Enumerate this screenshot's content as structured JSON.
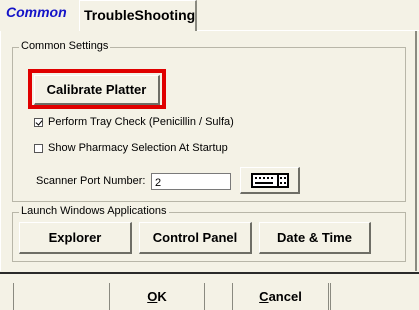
{
  "tabs": [
    {
      "label": "Common",
      "active": true
    },
    {
      "label": "TroubleShooting",
      "active": false
    }
  ],
  "common_settings": {
    "legend": "Common Settings",
    "calibrate_label": "Calibrate Platter",
    "tray_check": {
      "label": "Perform Tray Check (Penicillin / Sulfa)",
      "checked": true
    },
    "pharmacy_selection": {
      "label": "Show Pharmacy Selection At Startup",
      "checked": false
    },
    "scanner_port_label": "Scanner Port Number:",
    "scanner_port_value": "2",
    "keyboard_button_icon": "keyboard-icon"
  },
  "launch": {
    "legend": "Launch Windows Applications",
    "buttons": [
      "Explorer",
      "Control Panel",
      "Date & Time"
    ]
  },
  "footer": {
    "ok_first": "O",
    "ok_rest": "K",
    "cancel_first": "C",
    "cancel_rest": "ancel"
  },
  "colors": {
    "active_tab_text": "#1414c8",
    "highlight": "#e00000",
    "background": "#f4f2e6"
  }
}
